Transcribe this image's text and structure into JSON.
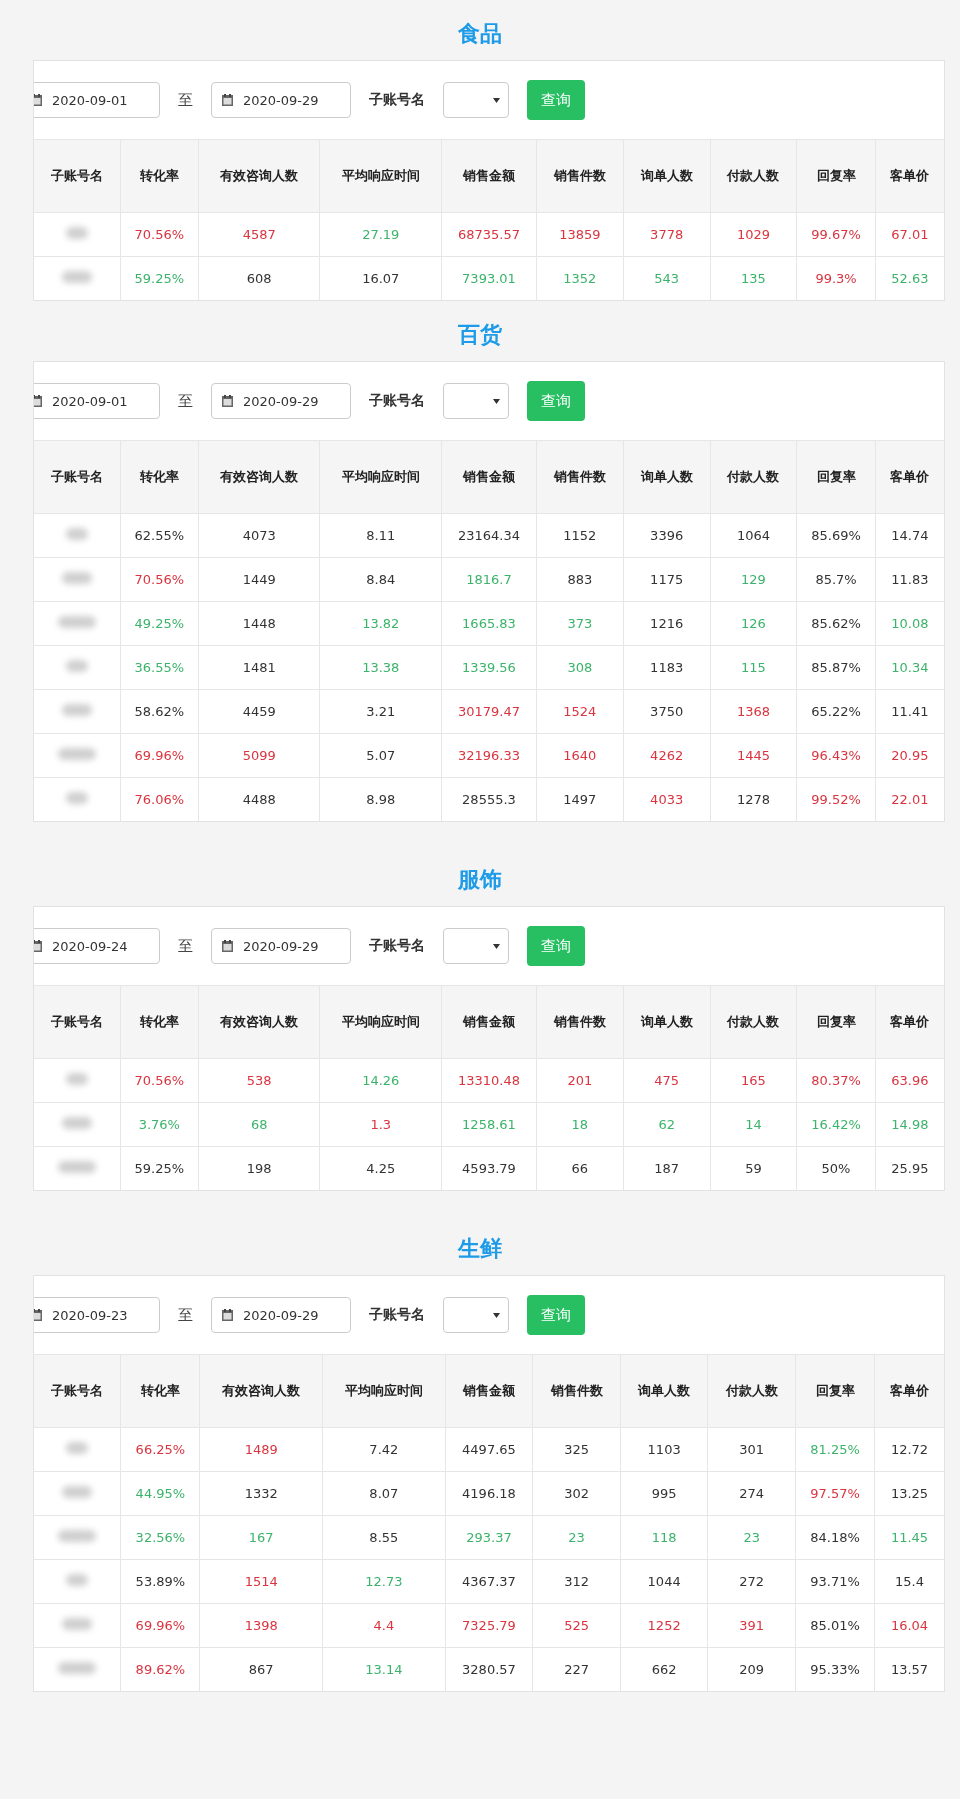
{
  "sections": [
    {
      "title": "食品",
      "filter": {
        "start_date": "2020-09-01",
        "separator": "至",
        "end_date": "2020-09-29",
        "account_label": "子账号名",
        "query_button": "查询"
      },
      "columns": [
        "子账号名",
        "转化率",
        "有效咨询人数",
        "平均响应时间",
        "销售金额",
        "销售件数",
        "询单人数",
        "付款人数",
        "回复率",
        "客单价"
      ],
      "rows": [
        [
          {
            "text": "",
            "kind": "redacted"
          },
          {
            "text": "70.56%",
            "color": "#d9343f"
          },
          {
            "text": "4587",
            "color": "#d9343f"
          },
          {
            "text": "27.19",
            "color": "#3bb36a"
          },
          {
            "text": "68735.57",
            "color": "#d9343f"
          },
          {
            "text": "13859",
            "color": "#d9343f"
          },
          {
            "text": "3778",
            "color": "#d9343f"
          },
          {
            "text": "1029",
            "color": "#d9343f"
          },
          {
            "text": "99.67%",
            "color": "#d9343f"
          },
          {
            "text": "67.01",
            "color": "#d9343f"
          }
        ],
        [
          {
            "text": "",
            "kind": "redacted"
          },
          {
            "text": "59.25%",
            "color": "#3bb36a"
          },
          {
            "text": "608"
          },
          {
            "text": "16.07"
          },
          {
            "text": "7393.01",
            "color": "#3bb36a"
          },
          {
            "text": "1352",
            "color": "#3bb36a"
          },
          {
            "text": "543",
            "color": "#3bb36a"
          },
          {
            "text": "135",
            "color": "#3bb36a"
          },
          {
            "text": "99.3%",
            "color": "#d9343f"
          },
          {
            "text": "52.63",
            "color": "#3bb36a"
          }
        ]
      ]
    },
    {
      "title": "百货",
      "filter": {
        "start_date": "2020-09-01",
        "separator": "至",
        "end_date": "2020-09-29",
        "account_label": "子账号名",
        "query_button": "查询"
      },
      "columns": [
        "子账号名",
        "转化率",
        "有效咨询人数",
        "平均响应时间",
        "销售金额",
        "销售件数",
        "询单人数",
        "付款人数",
        "回复率",
        "客单价"
      ],
      "rows": [
        [
          {
            "text": "",
            "kind": "redacted"
          },
          {
            "text": "62.55%"
          },
          {
            "text": "4073"
          },
          {
            "text": "8.11"
          },
          {
            "text": "23164.34"
          },
          {
            "text": "1152"
          },
          {
            "text": "3396"
          },
          {
            "text": "1064"
          },
          {
            "text": "85.69%"
          },
          {
            "text": "14.74"
          }
        ],
        [
          {
            "text": "",
            "kind": "redacted"
          },
          {
            "text": "70.56%",
            "color": "#d9343f"
          },
          {
            "text": "1449"
          },
          {
            "text": "8.84"
          },
          {
            "text": "1816.7",
            "color": "#3bb36a"
          },
          {
            "text": "883"
          },
          {
            "text": "1175"
          },
          {
            "text": "129",
            "color": "#3bb36a"
          },
          {
            "text": "85.7%"
          },
          {
            "text": "11.83"
          }
        ],
        [
          {
            "text": "",
            "kind": "redacted"
          },
          {
            "text": "49.25%",
            "color": "#3bb36a"
          },
          {
            "text": "1448"
          },
          {
            "text": "13.82",
            "color": "#3bb36a"
          },
          {
            "text": "1665.83",
            "color": "#3bb36a"
          },
          {
            "text": "373",
            "color": "#3bb36a"
          },
          {
            "text": "1216"
          },
          {
            "text": "126",
            "color": "#3bb36a"
          },
          {
            "text": "85.62%"
          },
          {
            "text": "10.08",
            "color": "#3bb36a"
          }
        ],
        [
          {
            "text": "",
            "kind": "redacted"
          },
          {
            "text": "36.55%",
            "color": "#3bb36a"
          },
          {
            "text": "1481"
          },
          {
            "text": "13.38",
            "color": "#3bb36a"
          },
          {
            "text": "1339.56",
            "color": "#3bb36a"
          },
          {
            "text": "308",
            "color": "#3bb36a"
          },
          {
            "text": "1183"
          },
          {
            "text": "115",
            "color": "#3bb36a"
          },
          {
            "text": "85.87%"
          },
          {
            "text": "10.34",
            "color": "#3bb36a"
          }
        ],
        [
          {
            "text": "",
            "kind": "redacted"
          },
          {
            "text": "58.62%"
          },
          {
            "text": "4459"
          },
          {
            "text": "3.21"
          },
          {
            "text": "30179.47",
            "color": "#d9343f"
          },
          {
            "text": "1524",
            "color": "#d9343f"
          },
          {
            "text": "3750"
          },
          {
            "text": "1368",
            "color": "#d9343f"
          },
          {
            "text": "65.22%"
          },
          {
            "text": "11.41"
          }
        ],
        [
          {
            "text": "",
            "kind": "redacted"
          },
          {
            "text": "69.96%",
            "color": "#d9343f"
          },
          {
            "text": "5099",
            "color": "#d9343f"
          },
          {
            "text": "5.07"
          },
          {
            "text": "32196.33",
            "color": "#d9343f"
          },
          {
            "text": "1640",
            "color": "#d9343f"
          },
          {
            "text": "4262",
            "color": "#d9343f"
          },
          {
            "text": "1445",
            "color": "#d9343f"
          },
          {
            "text": "96.43%",
            "color": "#d9343f"
          },
          {
            "text": "20.95",
            "color": "#d9343f"
          }
        ],
        [
          {
            "text": "",
            "kind": "redacted"
          },
          {
            "text": "76.06%",
            "color": "#d9343f"
          },
          {
            "text": "4488"
          },
          {
            "text": "8.98"
          },
          {
            "text": "28555.3"
          },
          {
            "text": "1497"
          },
          {
            "text": "4033",
            "color": "#d9343f"
          },
          {
            "text": "1278"
          },
          {
            "text": "99.52%",
            "color": "#d9343f"
          },
          {
            "text": "22.01",
            "color": "#d9343f"
          }
        ]
      ]
    },
    {
      "title": "服饰",
      "filter": {
        "start_date": "2020-09-24",
        "separator": "至",
        "end_date": "2020-09-29",
        "account_label": "子账号名",
        "query_button": "查询"
      },
      "columns": [
        "子账号名",
        "转化率",
        "有效咨询人数",
        "平均响应时间",
        "销售金额",
        "销售件数",
        "询单人数",
        "付款人数",
        "回复率",
        "客单价"
      ],
      "rows": [
        [
          {
            "text": "",
            "kind": "redacted"
          },
          {
            "text": "70.56%",
            "color": "#d9343f"
          },
          {
            "text": "538",
            "color": "#d9343f"
          },
          {
            "text": "14.26",
            "color": "#3bb36a"
          },
          {
            "text": "13310.48",
            "color": "#d9343f"
          },
          {
            "text": "201",
            "color": "#d9343f"
          },
          {
            "text": "475",
            "color": "#d9343f"
          },
          {
            "text": "165",
            "color": "#d9343f"
          },
          {
            "text": "80.37%",
            "color": "#d9343f"
          },
          {
            "text": "63.96",
            "color": "#d9343f"
          }
        ],
        [
          {
            "text": "",
            "kind": "redacted"
          },
          {
            "text": "3.76%",
            "color": "#3bb36a"
          },
          {
            "text": "68",
            "color": "#3bb36a"
          },
          {
            "text": "1.3",
            "color": "#d9343f"
          },
          {
            "text": "1258.61",
            "color": "#3bb36a"
          },
          {
            "text": "18",
            "color": "#3bb36a"
          },
          {
            "text": "62",
            "color": "#3bb36a"
          },
          {
            "text": "14",
            "color": "#3bb36a"
          },
          {
            "text": "16.42%",
            "color": "#3bb36a"
          },
          {
            "text": "14.98",
            "color": "#3bb36a"
          }
        ],
        [
          {
            "text": "",
            "kind": "redacted"
          },
          {
            "text": "59.25%"
          },
          {
            "text": "198"
          },
          {
            "text": "4.25"
          },
          {
            "text": "4593.79"
          },
          {
            "text": "66"
          },
          {
            "text": "187"
          },
          {
            "text": "59"
          },
          {
            "text": "50%"
          },
          {
            "text": "25.95"
          }
        ]
      ]
    },
    {
      "title": "生鲜",
      "filter": {
        "start_date": "2020-09-23",
        "separator": "至",
        "end_date": "2020-09-29",
        "account_label": "子账号名",
        "query_button": "查询"
      },
      "columns": [
        "子账号名",
        "转化率",
        "有效咨询人数",
        "平均响应时间",
        "销售金额",
        "销售件数",
        "询单人数",
        "付款人数",
        "回复率",
        "客单价"
      ],
      "rows": [
        [
          {
            "text": "",
            "kind": "redacted"
          },
          {
            "text": "66.25%",
            "color": "#d9343f"
          },
          {
            "text": "1489",
            "color": "#d9343f"
          },
          {
            "text": "7.42"
          },
          {
            "text": "4497.65"
          },
          {
            "text": "325"
          },
          {
            "text": "1103"
          },
          {
            "text": "301"
          },
          {
            "text": "81.25%",
            "color": "#3bb36a"
          },
          {
            "text": "12.72"
          }
        ],
        [
          {
            "text": "",
            "kind": "redacted"
          },
          {
            "text": "44.95%",
            "color": "#3bb36a"
          },
          {
            "text": "1332"
          },
          {
            "text": "8.07"
          },
          {
            "text": "4196.18"
          },
          {
            "text": "302"
          },
          {
            "text": "995"
          },
          {
            "text": "274"
          },
          {
            "text": "97.57%",
            "color": "#d9343f"
          },
          {
            "text": "13.25"
          }
        ],
        [
          {
            "text": "",
            "kind": "redacted"
          },
          {
            "text": "32.56%",
            "color": "#3bb36a"
          },
          {
            "text": "167",
            "color": "#3bb36a"
          },
          {
            "text": "8.55"
          },
          {
            "text": "293.37",
            "color": "#3bb36a"
          },
          {
            "text": "23",
            "color": "#3bb36a"
          },
          {
            "text": "118",
            "color": "#3bb36a"
          },
          {
            "text": "23",
            "color": "#3bb36a"
          },
          {
            "text": "84.18%"
          },
          {
            "text": "11.45",
            "color": "#3bb36a"
          }
        ],
        [
          {
            "text": "",
            "kind": "redacted"
          },
          {
            "text": "53.89%"
          },
          {
            "text": "1514",
            "color": "#d9343f"
          },
          {
            "text": "12.73",
            "color": "#3bb36a"
          },
          {
            "text": "4367.37"
          },
          {
            "text": "312"
          },
          {
            "text": "1044"
          },
          {
            "text": "272"
          },
          {
            "text": "93.71%"
          },
          {
            "text": "15.4"
          }
        ],
        [
          {
            "text": "",
            "kind": "redacted"
          },
          {
            "text": "69.96%",
            "color": "#d9343f"
          },
          {
            "text": "1398",
            "color": "#d9343f"
          },
          {
            "text": "4.4",
            "color": "#d9343f"
          },
          {
            "text": "7325.79",
            "color": "#d9343f"
          },
          {
            "text": "525",
            "color": "#d9343f"
          },
          {
            "text": "1252",
            "color": "#d9343f"
          },
          {
            "text": "391",
            "color": "#d9343f"
          },
          {
            "text": "85.01%"
          },
          {
            "text": "16.04",
            "color": "#d9343f"
          }
        ],
        [
          {
            "text": "",
            "kind": "redacted"
          },
          {
            "text": "89.62%",
            "color": "#d9343f"
          },
          {
            "text": "867"
          },
          {
            "text": "13.14",
            "color": "#3bb36a"
          },
          {
            "text": "3280.57"
          },
          {
            "text": "227"
          },
          {
            "text": "662"
          },
          {
            "text": "209"
          },
          {
            "text": "95.33%"
          },
          {
            "text": "13.57"
          }
        ]
      ]
    }
  ]
}
